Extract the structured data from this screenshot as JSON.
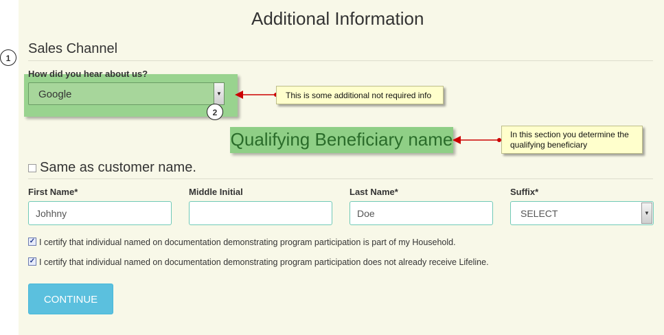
{
  "header": {
    "title": "Additional Information"
  },
  "sales_channel": {
    "section_title": "Sales Channel",
    "question": "How did you hear about us?",
    "selected": "Google"
  },
  "annotations": {
    "marker1": "1",
    "marker2": "2",
    "callout1": "This is some additional not required info",
    "callout2": "In this section you determine the qualifying beneficiary",
    "highlight_heading": "Qualifying Beneficiary name"
  },
  "beneficiary": {
    "same_as_customer_label": "Same as customer name.",
    "same_as_customer_checked": false,
    "fields": {
      "first_name": {
        "label": "First Name*",
        "value": "Johhny"
      },
      "middle_initial": {
        "label": "Middle Initial",
        "value": ""
      },
      "last_name": {
        "label": "Last Name*",
        "value": "Doe"
      },
      "suffix": {
        "label": "Suffix*",
        "value": "SELECT"
      }
    }
  },
  "certifications": [
    {
      "text": "I certify that individual named on documentation demonstrating program participation is part of my Household.",
      "checked": true
    },
    {
      "text": "I certify that individual named on documentation demonstrating program participation does not already receive Lifeline.",
      "checked": true
    }
  ],
  "actions": {
    "continue_label": "CONTINUE"
  },
  "colors": {
    "accent": "#5bc0de",
    "highlight": "#8fcf86",
    "callout_bg": "#ffffcc",
    "arrow": "#cc0000",
    "panel_bg": "#f8f8e8"
  },
  "icons": {
    "dropdown": "triangle-down-icon",
    "checkbox_checked": "check-icon"
  }
}
